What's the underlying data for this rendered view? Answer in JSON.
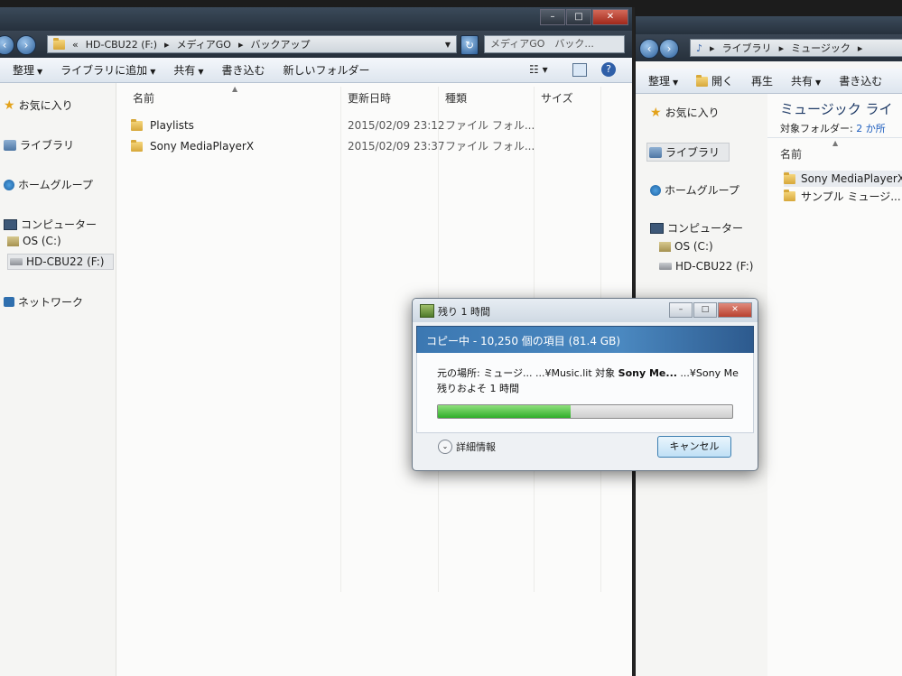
{
  "left_window": {
    "address": {
      "back_chevrons": "«",
      "crumbs": [
        "HD-CBU22 (F:)",
        "メディアGO",
        "バックアップ"
      ]
    },
    "search_placeholder": "メディアGO　バック...",
    "toolbar": [
      "整理",
      "ライブラリに追加",
      "共有",
      "書き込む",
      "新しいフォルダー"
    ],
    "nav": {
      "favorites": "お気に入り",
      "libraries": "ライブラリ",
      "homegroup": "ホームグループ",
      "computer": "コンピューター",
      "drive_c": "OS (C:)",
      "drive_f": "HD-CBU22 (F:)",
      "network": "ネットワーク"
    },
    "columns": {
      "name": "名前",
      "modified": "更新日時",
      "type": "種類",
      "size": "サイズ"
    },
    "files": [
      {
        "name": "Playlists",
        "modified": "2015/02/09 23:12",
        "type": "ファイル フォル..."
      },
      {
        "name": "Sony MediaPlayerX",
        "modified": "2015/02/09 23:37",
        "type": "ファイル フォル..."
      }
    ]
  },
  "right_window": {
    "address": {
      "crumbs": [
        "ライブラリ",
        "ミュージック"
      ]
    },
    "toolbar": [
      "整理",
      "開く",
      "再生",
      "共有",
      "書き込む"
    ],
    "nav": {
      "favorites": "お気に入り",
      "libraries": "ライブラリ",
      "homegroup": "ホームグループ",
      "computer": "コンピューター",
      "drive_c": "OS (C:)",
      "drive_f": "HD-CBU22 (F:)"
    },
    "library_title": "ミュージック ライ",
    "target_label": "対象フォルダー:",
    "target_link": "2 か所",
    "column_name": "名前",
    "files": [
      "Sony MediaPlayerX",
      "サンプル ミュージ..."
    ]
  },
  "copy_dialog": {
    "title": "残り 1 時間",
    "banner": "コピー中 - 10,250 個の項目 (81.4 GB)",
    "line1_prefix": "元の場所: ミュージ...  ...¥Music.lit 対象 ",
    "line1_bold": "Sony Me...",
    "line1_suffix": " ...¥Sony Me",
    "line2": "残りおよそ 1 時間",
    "progress": 0.45,
    "details": "詳細情報",
    "cancel": "キャンセル"
  }
}
